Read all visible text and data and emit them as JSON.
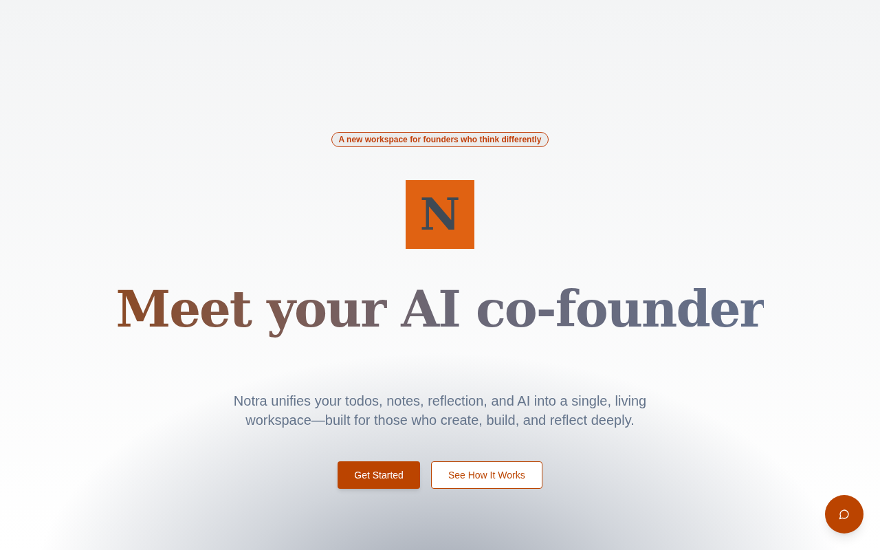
{
  "badge": "A new workspace for founders who think differently",
  "logo": {
    "letter": "N"
  },
  "headline": "Meet your AI co-founder",
  "subheadline": "Notra unifies your todos, notes, reflection, and AI into a single, living workspace—built for those who create, build, and reflect deeply.",
  "buttons": [
    {
      "label": "Get Started",
      "kind": "primary"
    },
    {
      "label": "See How It Works",
      "kind": "secondary"
    }
  ]
}
